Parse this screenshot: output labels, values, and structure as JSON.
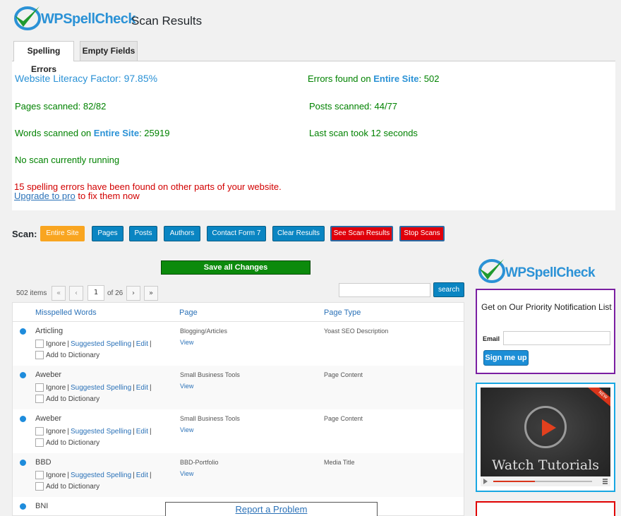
{
  "header": {
    "logo_text": "WPSpellCheck",
    "title": "Scan Results"
  },
  "tabs": [
    {
      "label": "Spelling Errors",
      "active": true
    },
    {
      "label": "Empty Fields",
      "active": false
    }
  ],
  "stats": {
    "literacy": "Website Literacy Factor: 97.85%",
    "errors_prefix": "Errors found on ",
    "errors_hl": "Entire Site",
    "errors_suffix": ": 502",
    "pages": "Pages scanned: 82/82",
    "posts": "Posts scanned: 44/77",
    "words_prefix": "Words scanned on ",
    "words_hl": "Entire Site",
    "words_suffix": ": 25919",
    "last_scan": "Last scan took 12 seconds",
    "running": "No scan currently running",
    "warning": "15 spelling errors have been found on other parts of your website.",
    "upgrade_link": "Upgrade to pro",
    "upgrade_suffix": " to fix them now"
  },
  "scan": {
    "label": "Scan:",
    "buttons": [
      "Entire Site",
      "Pages",
      "Posts",
      "Authors",
      "Contact Form 7",
      "Clear Results",
      "See Scan Results",
      "Stop Scans"
    ]
  },
  "save_label": "Save all Changes",
  "pagination": {
    "items": "502 items",
    "first": "«",
    "prev": "‹",
    "current": "1",
    "of": "of 26",
    "next": "›",
    "last": "»"
  },
  "search": {
    "button": "search"
  },
  "table": {
    "columns": [
      "Misspelled Words",
      "Page",
      "Page Type"
    ],
    "actions": {
      "ignore": "Ignore",
      "suggested": "Suggested Spelling",
      "edit": "Edit",
      "add": "Add to Dictionary",
      "view": "View",
      "sep": "|"
    },
    "rows": [
      {
        "word": "Articling",
        "page": "Blogging/Articles",
        "type": "Yoast SEO Description"
      },
      {
        "word": "Aweber",
        "page": "Small Business Tools",
        "type": "Page Content"
      },
      {
        "word": "Aweber",
        "page": "Small Business Tools",
        "type": "Page Content"
      },
      {
        "word": "BBD",
        "page": "BBD-Portfolio",
        "type": "Media Title"
      },
      {
        "word": "BNI",
        "page": "",
        "type": ""
      }
    ]
  },
  "report_label": "Report a Problem",
  "sidebar": {
    "logo_text": "WPSpellCheck",
    "notify_title": "Get on Our Priority Notification List",
    "email_label": "Email",
    "signup": "Sign me up",
    "video_caption": "Watch Tutorials",
    "video_badge": "NEW",
    "video_progress": 0.42
  },
  "colors": {
    "accent": "#2b92d6",
    "green": "#008200",
    "red": "#d20000",
    "button": "#0a85c2"
  }
}
